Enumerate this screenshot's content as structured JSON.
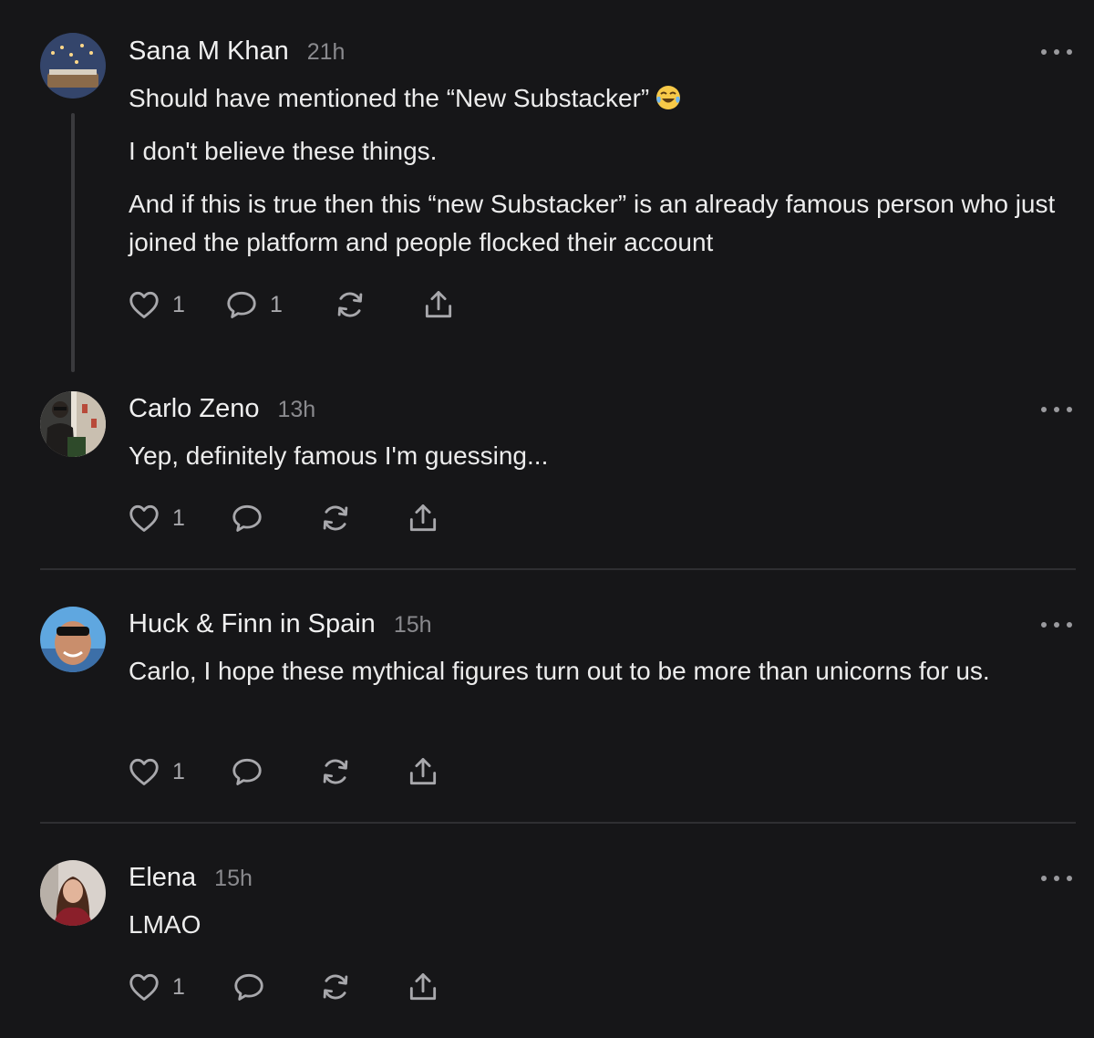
{
  "comments": [
    {
      "author": "Sana M Khan",
      "time": "21h",
      "paragraphs": [
        "Should have mentioned the “New Substacker”",
        "I don't believe these things.",
        "And if this is true then this “new Substacker” is an already famous person who just joined the platform and people flocked their account"
      ],
      "emoji": "tears-of-joy-emoji",
      "likes": "1",
      "replies": "1"
    },
    {
      "author": "Carlo Zeno",
      "time": "13h",
      "paragraphs": [
        "Yep, definitely famous I'm guessing..."
      ],
      "likes": "1"
    },
    {
      "author": "Huck & Finn in Spain",
      "time": "15h",
      "paragraphs": [
        "Carlo, I hope these mythical figures turn out to be more than unicorns for us."
      ],
      "likes": "1"
    },
    {
      "author": "Elena",
      "time": "15h",
      "paragraphs": [
        "LMAO"
      ],
      "likes": "1"
    }
  ],
  "icons": {
    "like": "heart-icon",
    "reply": "comment-bubble-icon",
    "restack": "restack-icon",
    "share": "share-icon",
    "more": "more-options-icon"
  },
  "colors": {
    "background": "#161618",
    "text": "#ececec",
    "muted": "#8a8a8e",
    "divider": "#2f2f32"
  }
}
